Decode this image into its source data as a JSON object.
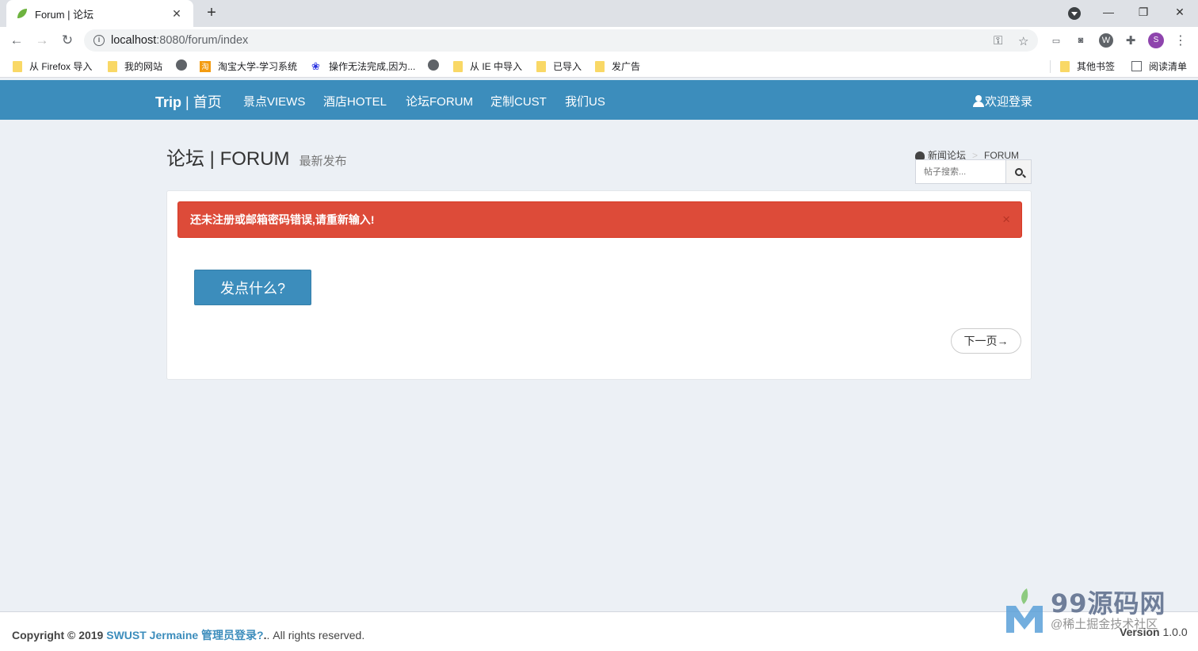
{
  "browser": {
    "tab_title": "Forum | 论坛",
    "url_host": "localhost",
    "url_path": ":8080/forum/index",
    "avatar_letter": "S",
    "bookmarks": [
      "从 Firefox 导入",
      "我的网站",
      "淘宝大学-学习系统",
      "操作无法完成,因为...",
      "从 IE 中导入",
      "已导入",
      "发广告"
    ],
    "other_bookmarks": "其他书签",
    "reading_list": "阅读清单"
  },
  "nav": {
    "brand_strong": "Trip",
    "brand_rest": " | 首页",
    "links": [
      "景点VIEWS",
      "酒店HOTEL",
      "论坛FORUM",
      "定制CUST",
      "我们US"
    ],
    "login": "欢迎登录"
  },
  "header": {
    "title": "论坛 | FORUM",
    "subtitle": "最新发布",
    "breadcrumb": [
      "新闻论坛",
      "FORUM"
    ],
    "search_placeholder": "帖子搜索..."
  },
  "alert": {
    "message": "还未注册或邮箱密码错误,请重新输入!",
    "close": "×"
  },
  "actions": {
    "post": "发点什么?",
    "next": "下一页→"
  },
  "footer": {
    "copyright_prefix": "Copyright © 2019",
    "link": "SWUST Jermaine 管理员登录?",
    "suffix": ". All rights reserved.",
    "version_label": "Version",
    "version_value": "1.0.0"
  },
  "watermark": {
    "title": "99源码网",
    "subtitle": "@稀土掘金技术社区"
  },
  "colors": {
    "primary": "#3c8dbc",
    "danger": "#dd4b39",
    "background": "#ecf0f5"
  }
}
